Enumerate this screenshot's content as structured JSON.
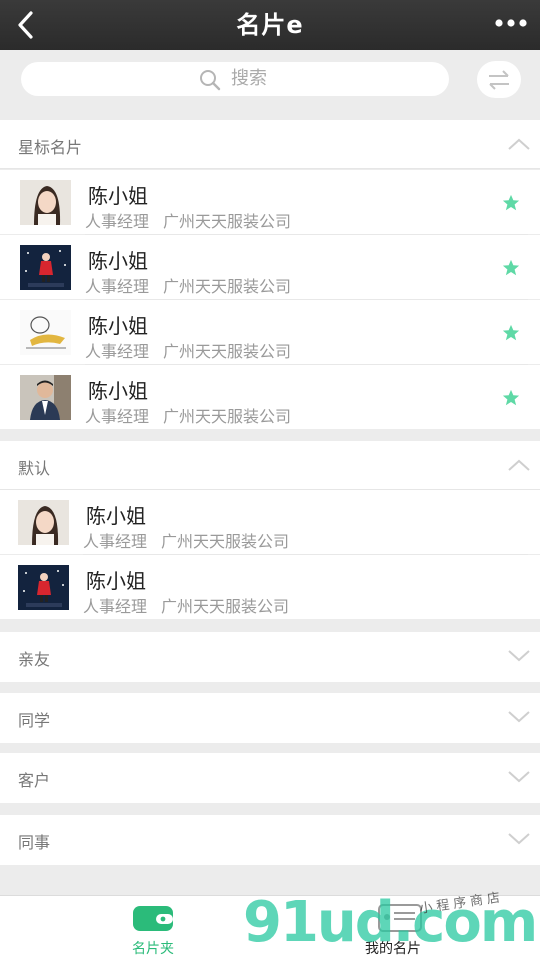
{
  "header": {
    "title": "名片e",
    "back_icon": "chevron-left-icon",
    "more_icon": "more-dots-icon"
  },
  "search": {
    "placeholder": "搜索"
  },
  "sections": {
    "starred": {
      "title": "星标名片",
      "expanded": true
    },
    "default": {
      "title": "默认",
      "expanded": true
    },
    "relatives": {
      "title": "亲友"
    },
    "classmates": {
      "title": "同学"
    },
    "clients": {
      "title": "客户"
    },
    "colleagues": {
      "title": "同事"
    }
  },
  "starred_cards": [
    {
      "name": "陈小姐",
      "position": "人事经理",
      "company": "广州天天服装公司",
      "avatar": "woman-photo",
      "starred": true
    },
    {
      "name": "陈小姐",
      "position": "人事经理",
      "company": "广州天天服装公司",
      "avatar": "goodnight-illustration",
      "starred": true
    },
    {
      "name": "陈小姐",
      "position": "人事经理",
      "company": "广州天天服装公司",
      "avatar": "cartoon-sketch",
      "starred": true
    },
    {
      "name": "陈小姐",
      "position": "人事经理",
      "company": "广州天天服装公司",
      "avatar": "man-photo",
      "starred": true
    }
  ],
  "default_cards": [
    {
      "name": "陈小姐",
      "position": "人事经理",
      "company": "广州天天服装公司",
      "avatar": "woman-photo"
    },
    {
      "name": "陈小姐",
      "position": "人事经理",
      "company": "广州天天服装公司",
      "avatar": "goodnight-illustration"
    }
  ],
  "tabs": [
    {
      "label": "名片夹",
      "icon": "wallet-icon",
      "active": true
    },
    {
      "label": "我的名片",
      "icon": "id-card-icon",
      "active": false
    }
  ],
  "watermark": {
    "text": "91ud.com",
    "tagline": "小程序商店"
  },
  "colors": {
    "accent": "#2bbb7a",
    "star": "#5fd9a6",
    "topbar": "#2f2f2f"
  }
}
